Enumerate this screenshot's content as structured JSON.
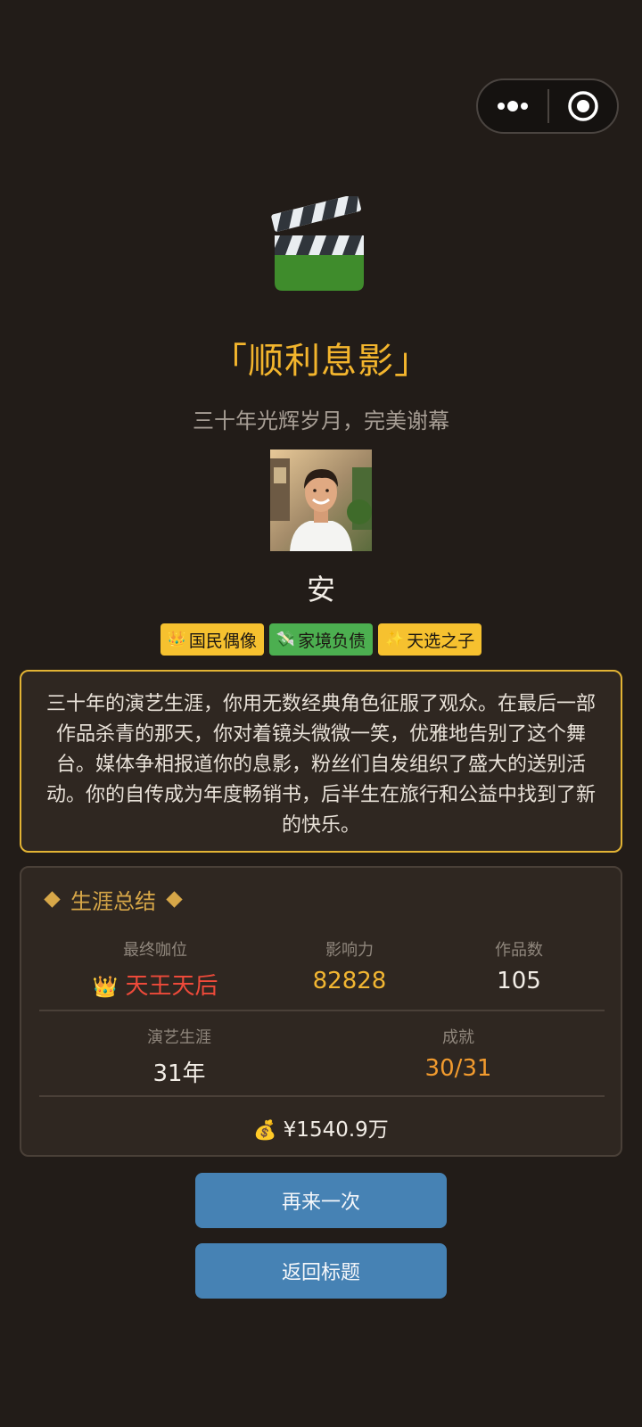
{
  "capsule": {
    "more_icon": "more-dots-icon",
    "close_icon": "target-close-icon"
  },
  "ending": {
    "icon": "clapperboard-icon",
    "title": "「顺利息影」",
    "subtitle": "三十年光辉岁月，完美谢幕"
  },
  "player": {
    "name": "安",
    "tags": [
      {
        "icon": "crown-emoji",
        "glyph": "👑",
        "label": "国民偶像",
        "color": "#f6c12f"
      },
      {
        "icon": "money-wings-emoji",
        "glyph": "💸",
        "label": "家境负债",
        "color": "#4caf50"
      },
      {
        "icon": "sparkles-emoji",
        "glyph": "✨",
        "label": "天选之子",
        "color": "#f6c12f"
      }
    ]
  },
  "story": "三十年的演艺生涯，你用无数经典角色征服了观众。在最后一部作品杀青的那天，你对着镜头微微一笑，优雅地告别了这个舞台。媒体争相报道你的息影，粉丝们自发组织了盛大的送别活动。你的自传成为年度畅销书，后半生在旅行和公益中找到了新的快乐。",
  "summary": {
    "title": "生涯总结",
    "rank": {
      "label": "最终咖位",
      "icon": "crown-emoji",
      "glyph": "👑",
      "value": "天王天后",
      "color": "#ee4a3a"
    },
    "influence": {
      "label": "影响力",
      "value": "82828",
      "color": "#f2b632"
    },
    "works": {
      "label": "作品数",
      "value": "105",
      "color": "#f2ede6"
    },
    "career": {
      "label": "演艺生涯",
      "value": "31年",
      "color": "#f2ede6"
    },
    "achievements": {
      "label": "成就",
      "value": "30/31",
      "color": "#f29b2e"
    },
    "money": {
      "icon": "money-bag-emoji",
      "glyph": "💰",
      "value": "¥1540.9万",
      "color": "#f2ede6"
    }
  },
  "buttons": {
    "retry": "再来一次",
    "back": "返回标题"
  }
}
